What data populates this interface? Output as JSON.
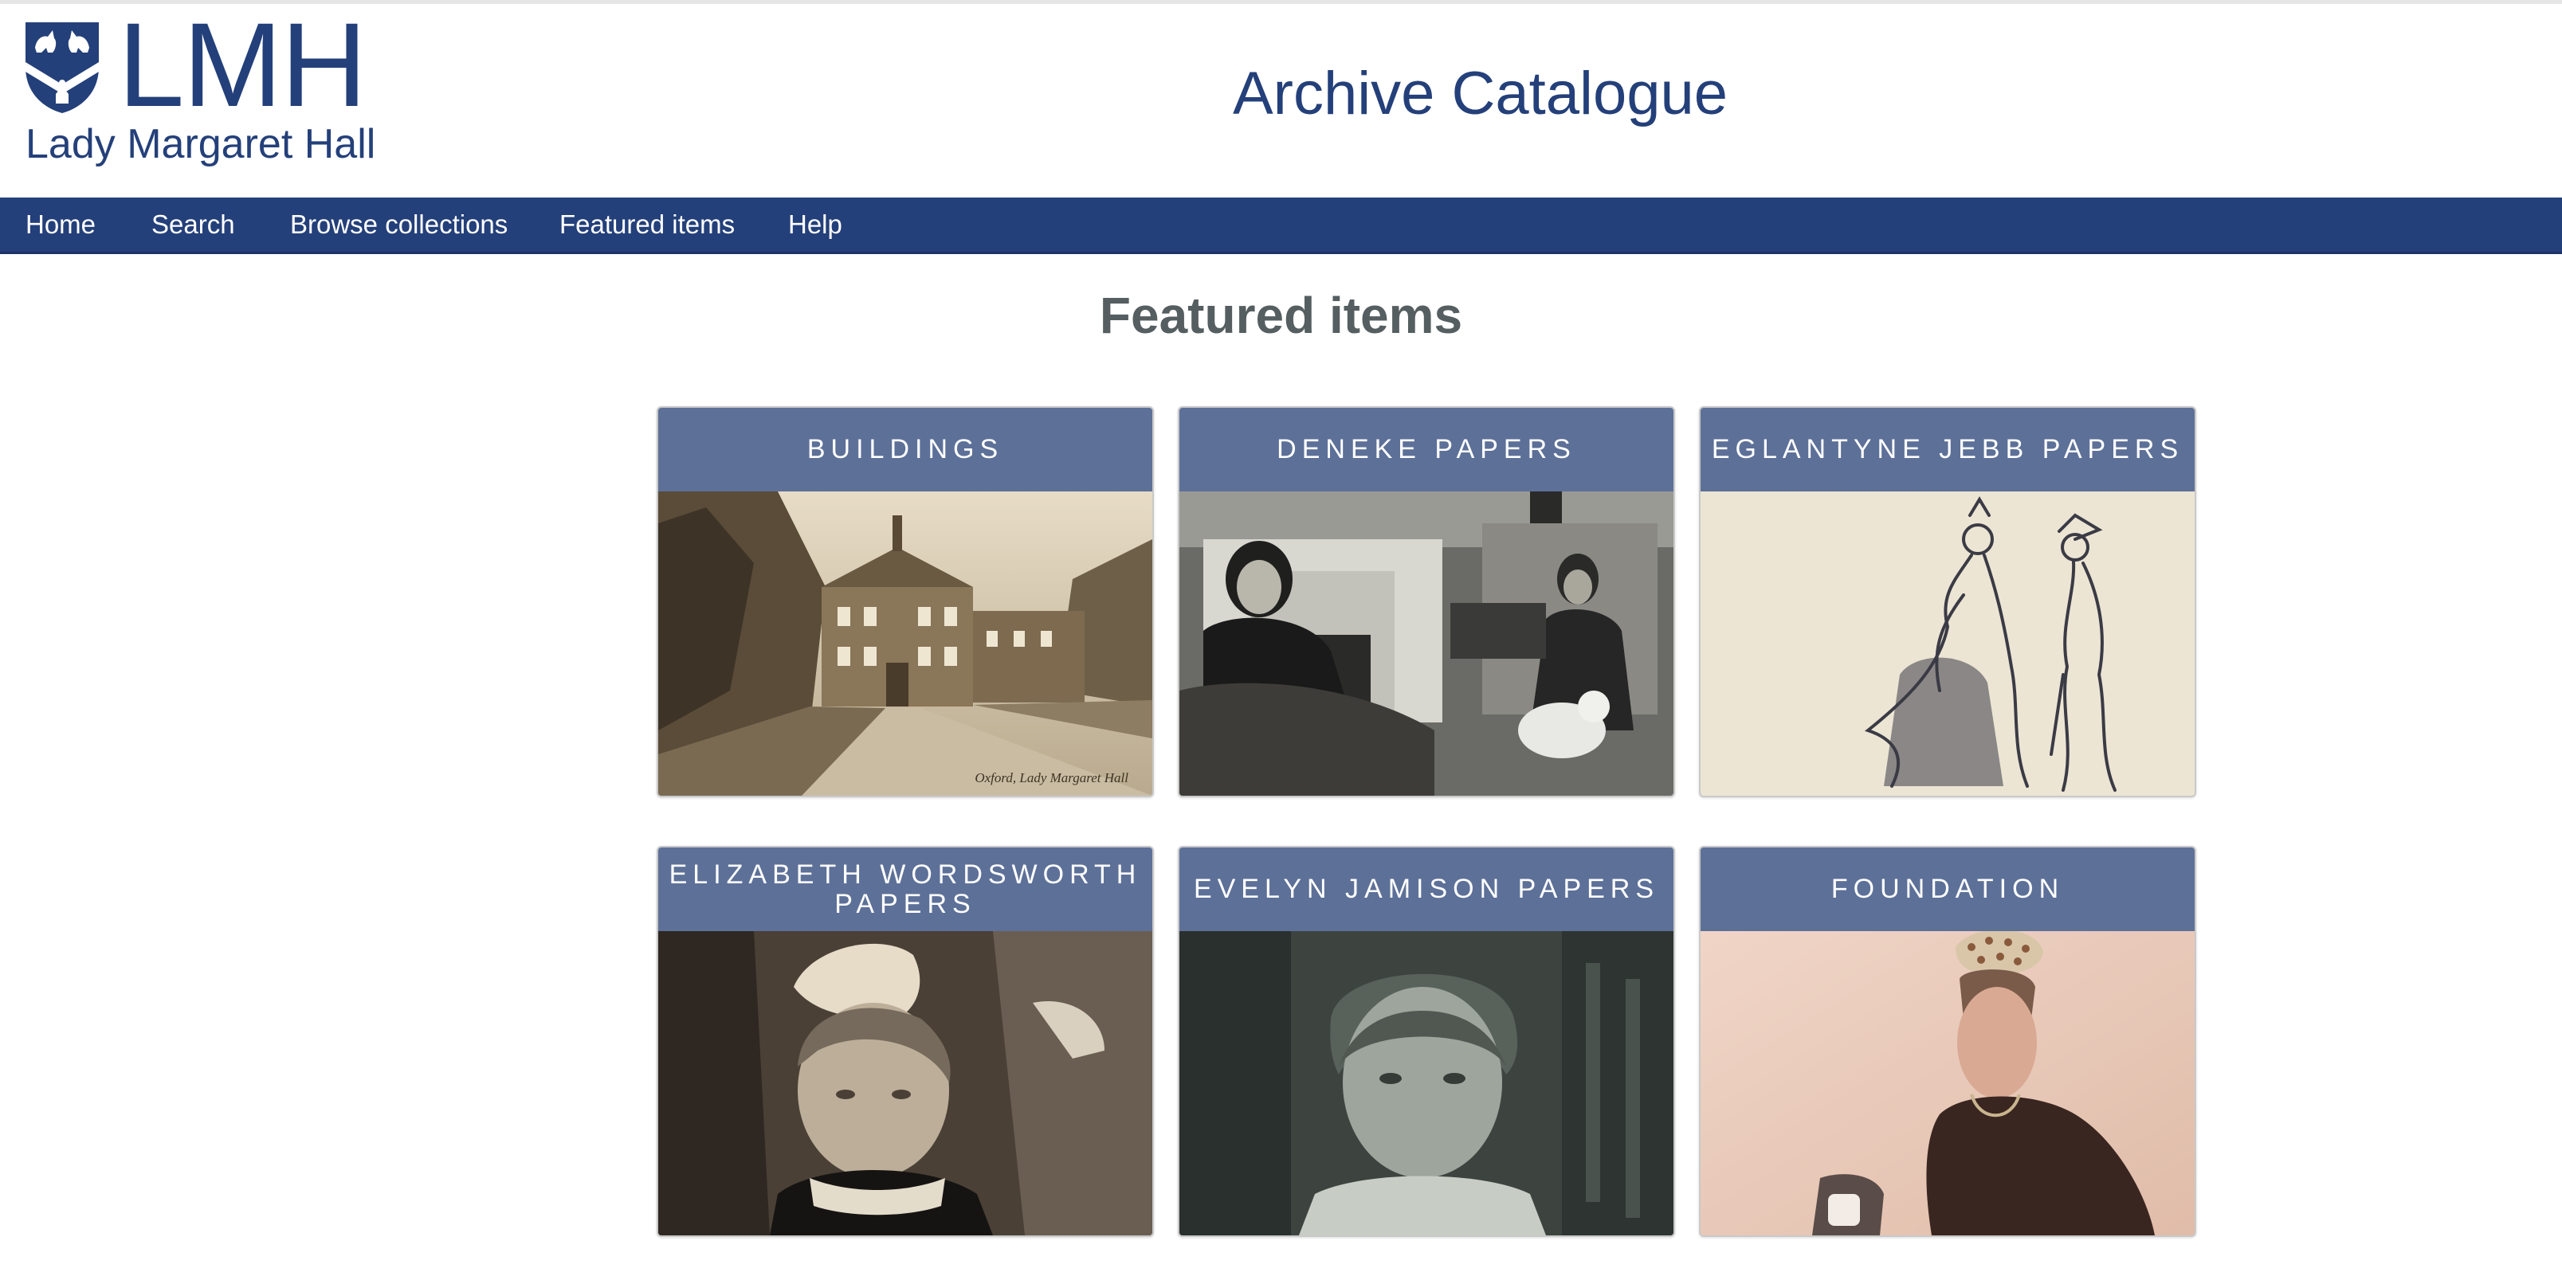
{
  "logo": {
    "short": "LMH",
    "full": "Lady Margaret Hall"
  },
  "site_title": "Archive Catalogue",
  "nav": [
    "Home",
    "Search",
    "Browse collections",
    "Featured items",
    "Help"
  ],
  "page_heading": "Featured items",
  "cards": [
    {
      "title": "BUILDINGS",
      "caption": "Oxford, Lady Margaret Hall"
    },
    {
      "title": "DENEKE PAPERS"
    },
    {
      "title": "EGLANTYNE JEBB PAPERS"
    },
    {
      "title": "ELIZABETH WORDSWORTH PAPERS"
    },
    {
      "title": "EVELYN JAMISON PAPERS"
    },
    {
      "title": "FOUNDATION"
    }
  ],
  "colors": {
    "brand_blue": "#24407a",
    "card_header": "#5d7098",
    "heading_grey": "#555e60"
  },
  "icons": [
    "college-crest-icon"
  ]
}
